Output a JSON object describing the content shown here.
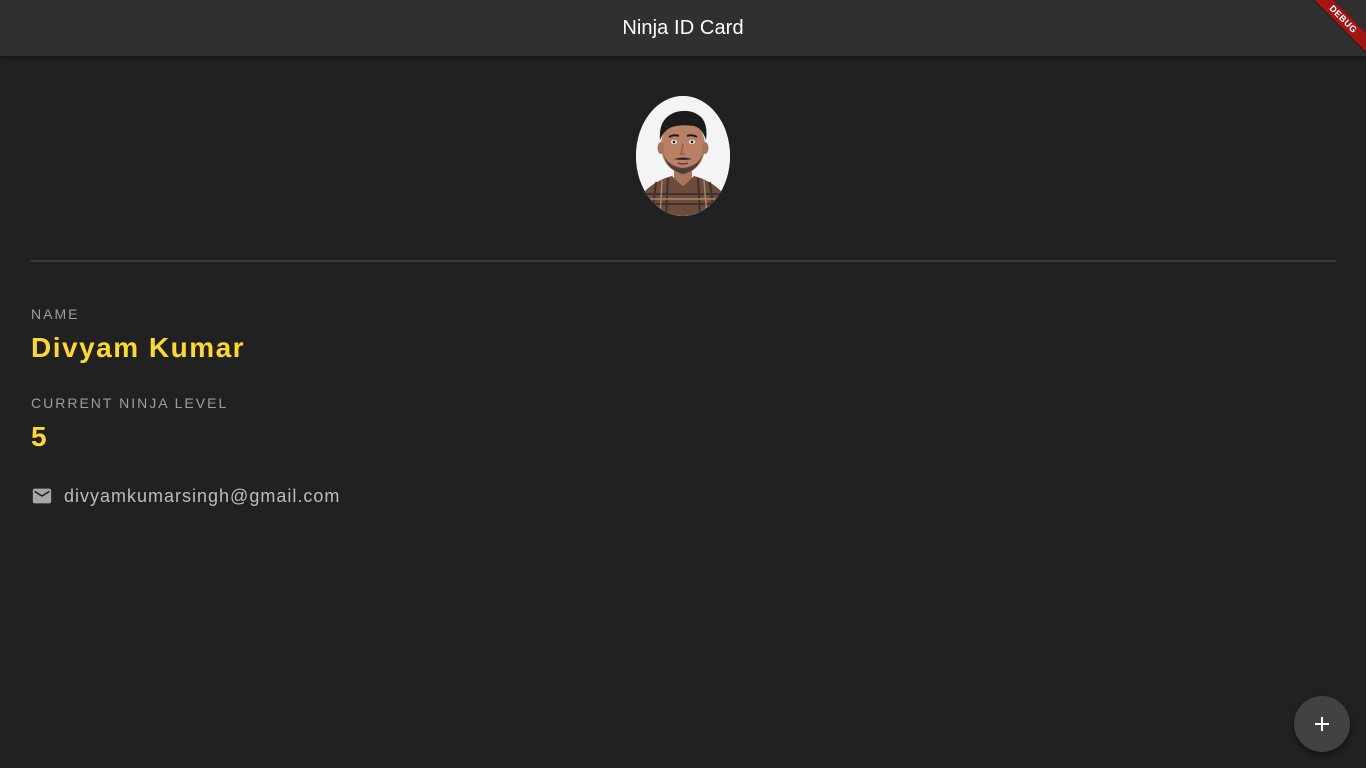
{
  "app_bar": {
    "title": "Ninja ID Card"
  },
  "debug_banner": {
    "label": "DEBUG"
  },
  "profile": {
    "avatar_icon": "person-photo",
    "name_label": "NAME",
    "name_value": "Divyam Kumar",
    "level_label": "CURRENT NINJA LEVEL",
    "level_value": "5",
    "email_icon": "mail-icon",
    "email": "divyamkumarsingh@gmail.com"
  },
  "fab": {
    "icon": "add-icon"
  },
  "colors": {
    "background": "#212121",
    "app_bar": "#303030",
    "accent": "#fdd835",
    "label": "#9e9e9e",
    "fab": "#424242",
    "debug_banner": "#a31515"
  }
}
